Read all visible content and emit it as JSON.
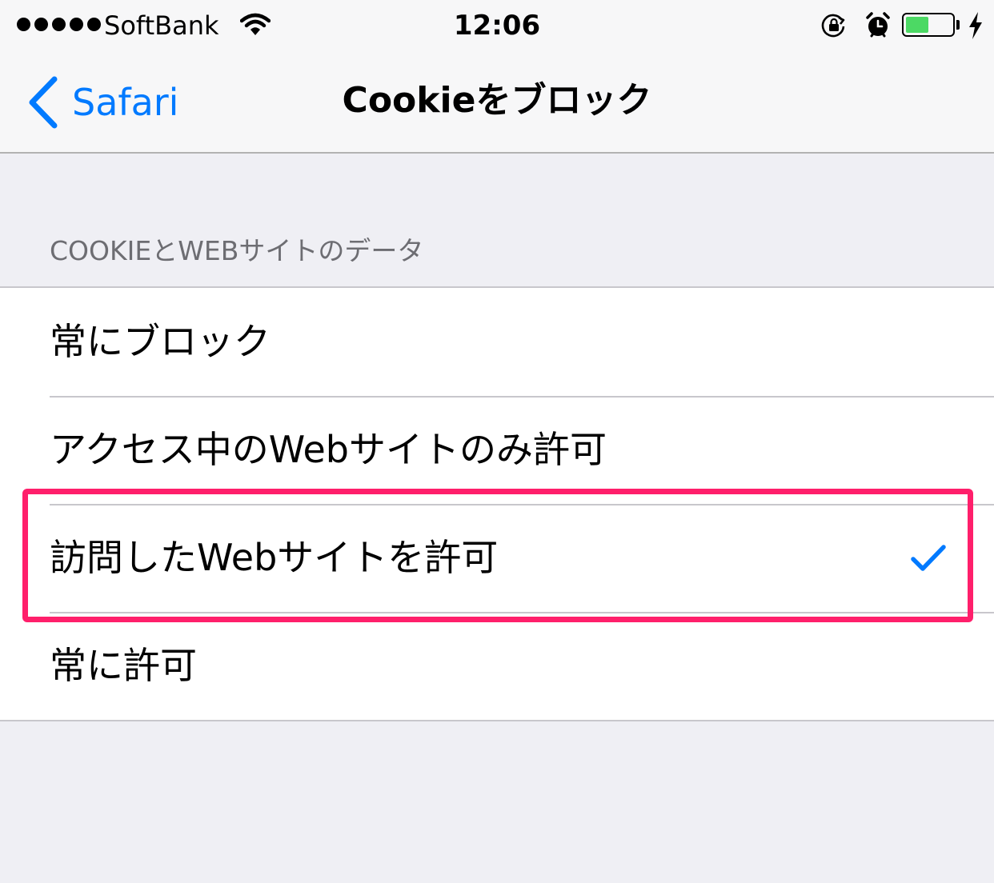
{
  "status_bar": {
    "carrier": "SoftBank",
    "time": "12:06",
    "signal_bars": 5,
    "battery_level": 0.5,
    "battery_color": "#4cd964",
    "icons": [
      "wifi-icon",
      "rotation-lock-icon",
      "alarm-icon",
      "battery-icon",
      "charging-icon"
    ]
  },
  "nav": {
    "back_label": "Safari",
    "title": "Cookieをブロック"
  },
  "section": {
    "header": "COOKIEとWEBサイトのデータ",
    "options": [
      {
        "label": "常にブロック",
        "selected": false
      },
      {
        "label": "アクセス中のWebサイトのみ許可",
        "selected": false
      },
      {
        "label": "訪問したWebサイトを許可",
        "selected": true
      },
      {
        "label": "常に許可",
        "selected": false
      }
    ]
  },
  "colors": {
    "accent": "#007aff",
    "highlight": "#ff1f6b",
    "background": "#efeff4"
  }
}
